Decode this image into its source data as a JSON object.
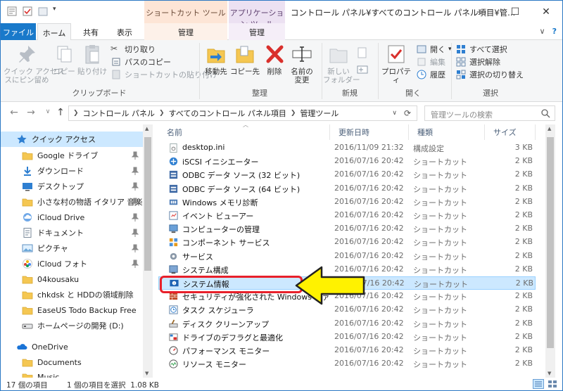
{
  "window": {
    "title": "コントロール パネル¥すべてのコントロール パネル項目¥管...",
    "context_tab_shortcut": "ショートカット ツール",
    "context_tab_app": "アプリケーション ツール",
    "minimize": "—",
    "maximize": "☐",
    "close": "✕"
  },
  "ribbon_tabs": {
    "file": "ファイル",
    "home": "ホーム",
    "share": "共有",
    "view": "表示",
    "manage1": "管理",
    "manage2": "管理",
    "collapse": "∨",
    "help": "?"
  },
  "ribbon": {
    "clipboard": {
      "pin_label": "クイック アクセス\nスにピン留め",
      "copy": "コピー",
      "paste": "貼り付け",
      "cut": "切り取り",
      "copy_path": "パスのコピー",
      "paste_shortcut": "ショートカットの貼り付け",
      "group": "クリップボード"
    },
    "organize": {
      "move_to": "移動先",
      "copy_to": "コピー先",
      "delete": "削除",
      "rename": "名前の\n変更",
      "group": "整理"
    },
    "new": {
      "new_folder": "新しい\nフォルダー",
      "group": "新規"
    },
    "open": {
      "properties": "プロパティ",
      "open": "開く",
      "edit": "編集",
      "history": "履歴",
      "group": "開く"
    },
    "select": {
      "select_all": "すべて選択",
      "select_none": "選択解除",
      "invert": "選択の切り替え",
      "group": "選択"
    }
  },
  "address": {
    "crumbs": [
      "コントロール パネル",
      "すべてのコントロール パネル項目",
      "管理ツール"
    ],
    "search_placeholder": "管理ツールの検索"
  },
  "nav": [
    {
      "label": "クイック アクセス",
      "icon": "star-icon",
      "pinned": false,
      "indent": 0,
      "selected": true
    },
    {
      "label": "Google ドライブ",
      "icon": "folder-icon",
      "pinned": true,
      "indent": 1
    },
    {
      "label": "ダウンロード",
      "icon": "download-icon",
      "pinned": true,
      "indent": 1
    },
    {
      "label": "デスクトップ",
      "icon": "desktop-icon",
      "pinned": true,
      "indent": 1
    },
    {
      "label": "小さな村の物語 イタリア 音楽集",
      "icon": "folder-icon",
      "pinned": true,
      "indent": 1
    },
    {
      "label": "iCloud Drive",
      "icon": "cloud-icon",
      "pinned": true,
      "indent": 1
    },
    {
      "label": "ドキュメント",
      "icon": "documents-icon",
      "pinned": true,
      "indent": 1
    },
    {
      "label": "ピクチャ",
      "icon": "pictures-icon",
      "pinned": true,
      "indent": 1
    },
    {
      "label": "iCloud フォト",
      "icon": "photos-icon",
      "pinned": true,
      "indent": 1
    },
    {
      "label": "04kousaku",
      "icon": "folder-icon",
      "pinned": false,
      "indent": 1
    },
    {
      "label": "chkdsk と HDDの領域削除",
      "icon": "folder-icon",
      "pinned": false,
      "indent": 1
    },
    {
      "label": "EaseUS Todo Backup Free",
      "icon": "folder-icon",
      "pinned": false,
      "indent": 1
    },
    {
      "label": "ホームページの開発 (D:)",
      "icon": "drive-icon",
      "pinned": false,
      "indent": 1
    },
    {
      "label": "OneDrive",
      "icon": "onedrive-icon",
      "pinned": false,
      "indent": 0
    },
    {
      "label": "Documents",
      "icon": "folder-icon",
      "pinned": false,
      "indent": 1
    },
    {
      "label": "Music",
      "icon": "folder-icon",
      "pinned": false,
      "indent": 1
    }
  ],
  "columns": {
    "name": "名前",
    "date": "更新日時",
    "type": "種類",
    "size": "サイズ"
  },
  "files": [
    {
      "name": "desktop.ini",
      "date": "2016/11/09 21:32",
      "type": "構成設定",
      "size": "3 KB",
      "icon": "ini-file-icon"
    },
    {
      "name": "iSCSI イニシエーター",
      "date": "2016/07/16 20:42",
      "type": "ショートカット",
      "size": "2 KB",
      "icon": "iscsi-icon"
    },
    {
      "name": "ODBC データ ソース (32 ビット)",
      "date": "2016/07/16 20:42",
      "type": "ショートカット",
      "size": "2 KB",
      "icon": "odbc-icon"
    },
    {
      "name": "ODBC データ ソース (64 ビット)",
      "date": "2016/07/16 20:42",
      "type": "ショートカット",
      "size": "2 KB",
      "icon": "odbc-icon"
    },
    {
      "name": "Windows メモリ診断",
      "date": "2016/07/16 20:42",
      "type": "ショートカット",
      "size": "2 KB",
      "icon": "memory-diagnostic-icon"
    },
    {
      "name": "イベント ビューアー",
      "date": "2016/07/16 20:42",
      "type": "ショートカット",
      "size": "2 KB",
      "icon": "event-viewer-icon"
    },
    {
      "name": "コンピューターの管理",
      "date": "2016/07/16 20:42",
      "type": "ショートカット",
      "size": "2 KB",
      "icon": "computer-management-icon"
    },
    {
      "name": "コンポーネント サービス",
      "date": "2016/07/16 20:42",
      "type": "ショートカット",
      "size": "2 KB",
      "icon": "component-services-icon"
    },
    {
      "name": "サービス",
      "date": "2016/07/16 20:42",
      "type": "ショートカット",
      "size": "2 KB",
      "icon": "services-icon"
    },
    {
      "name": "システム構成",
      "date": "2016/07/16 20:42",
      "type": "ショートカット",
      "size": "2 KB",
      "icon": "system-config-icon"
    },
    {
      "name": "システム情報",
      "date": "2016/07/16 20:42",
      "type": "ショートカット",
      "size": "2 KB",
      "icon": "system-info-icon",
      "selected": true
    },
    {
      "name": "セキュリティが強化された Windows ファイアウォール",
      "date": "2016/07/16 20:42",
      "type": "ショートカット",
      "size": "2 KB",
      "icon": "firewall-icon"
    },
    {
      "name": "タスク スケジューラ",
      "date": "2016/07/16 20:42",
      "type": "ショートカット",
      "size": "2 KB",
      "icon": "task-scheduler-icon"
    },
    {
      "name": "ディスク クリーンアップ",
      "date": "2016/07/16 20:42",
      "type": "ショートカット",
      "size": "2 KB",
      "icon": "disk-cleanup-icon"
    },
    {
      "name": "ドライブのデフラグと最適化",
      "date": "2016/07/16 20:42",
      "type": "ショートカット",
      "size": "2 KB",
      "icon": "defrag-icon"
    },
    {
      "name": "パフォーマンス モニター",
      "date": "2016/07/16 20:42",
      "type": "ショートカット",
      "size": "2 KB",
      "icon": "performance-monitor-icon"
    },
    {
      "name": "リソース モニター",
      "date": "2016/07/16 20:42",
      "type": "ショートカット",
      "size": "2 KB",
      "icon": "resource-monitor-icon"
    }
  ],
  "status": {
    "count": "17 個の項目",
    "selection": "1 個の項目を選択  1.08 KB"
  },
  "colors": {
    "accent": "#1979ca",
    "selection": "#cce8ff",
    "highlight": "#e8202a",
    "arrow_fill": "#fff200"
  }
}
